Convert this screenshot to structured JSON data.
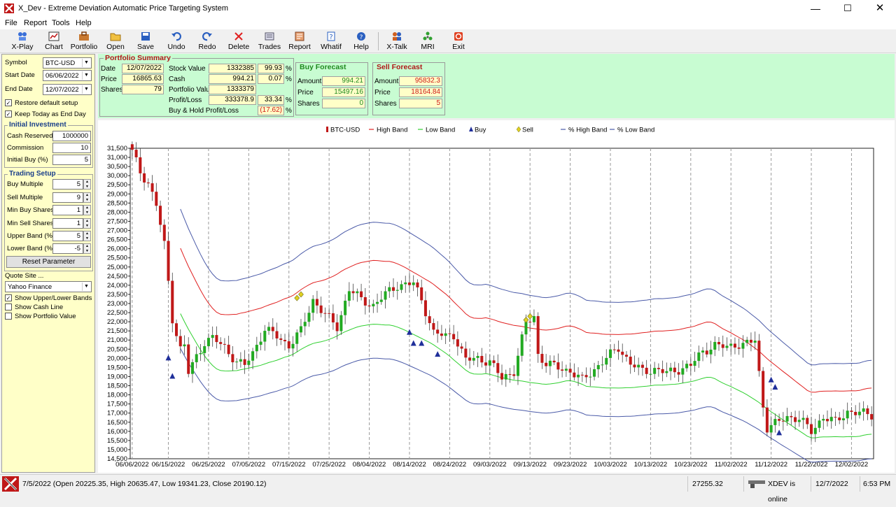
{
  "window": {
    "title": "X_Dev - Extreme Deviation Automatic Price Targeting System"
  },
  "menu": [
    "File",
    "Report",
    "Tools",
    "Help"
  ],
  "toolbar": [
    {
      "label": "X-Play",
      "icon": "play-icon"
    },
    {
      "label": "Chart",
      "icon": "chart-icon"
    },
    {
      "label": "Portfolio",
      "icon": "portfolio-icon"
    },
    {
      "label": "Open",
      "icon": "open-folder-icon"
    },
    {
      "label": "Save",
      "icon": "save-disk-icon"
    },
    {
      "label": "Undo",
      "icon": "undo-icon"
    },
    {
      "label": "Redo",
      "icon": "redo-icon"
    },
    {
      "label": "Delete",
      "icon": "delete-x-icon"
    },
    {
      "label": "Trades",
      "icon": "trades-icon"
    },
    {
      "label": "Report",
      "icon": "report-icon"
    },
    {
      "label": "Whatif",
      "icon": "whatif-icon"
    },
    {
      "label": "Help",
      "icon": "help-icon"
    },
    {
      "label": "X-Talk",
      "icon": "xtalk-icon"
    },
    {
      "label": "MRI",
      "icon": "mri-icon"
    },
    {
      "label": "Exit",
      "icon": "exit-icon"
    }
  ],
  "left": {
    "symbol_label": "Symbol",
    "symbol": "BTC-USD",
    "start_label": "Start Date",
    "start": "06/06/2022",
    "end_label": "End Date",
    "end": "12/07/2022",
    "restore_label": "Restore default setup",
    "keep_label": "Keep Today as End Day",
    "initial_head": "Initial Investment",
    "cash_label": "Cash Reserved",
    "cash": "1000000",
    "commission_label": "Commission",
    "commission": "10",
    "initbuy_label": "Initial Buy (%)",
    "initbuy": "5",
    "trading_head": "Trading Setup",
    "buym_label": "Buy Multiple",
    "buym": "5",
    "sellm_label": "Sell Multiple",
    "sellm": "9",
    "minbuy_label": "Min Buy Shares",
    "minbuy": "1",
    "minsell_label": "Min Sell Shares",
    "minsell": "1",
    "upper_label": "Upper Band (%)",
    "upper": "5",
    "lower_label": "Lower Band (%)",
    "lower": "-5",
    "reset_label": "Reset Parameter",
    "quote_label": "Quote Site ...",
    "quote": "Yahoo Finance",
    "show_bands_label": "Show Upper/Lower Bands",
    "show_cash_label": "Show Cash Line",
    "show_portfolio_label": "Show Portfolio Value"
  },
  "summary": {
    "head": "Portfolio Summary",
    "date_label": "Date",
    "date": "12/07/2022",
    "price_label": "Price",
    "price": "16865.63",
    "shares_label": "Shares",
    "shares": "79",
    "stock_label": "Stock Value",
    "stock": "1332385",
    "stock_pct": "99.93",
    "cash_label": "Cash",
    "cash": "994.21",
    "cash_pct": "0.07",
    "pv_label": "Portfolio Value",
    "pv": "1333379",
    "pl_label": "Profit/Loss",
    "pl": "333378.9",
    "pl_pct": "33.34",
    "bh_label": "Buy & Hold Profit/Loss",
    "bh_pct": "(17.62)",
    "pct": "%",
    "buy_head": "Buy Forecast",
    "buy_amount": "994.21",
    "buy_price": "15497.16",
    "buy_shares": "0",
    "sell_head": "Sell Forecast",
    "sell_amount": "95832.3",
    "sell_price": "18164.84",
    "sell_shares": "5",
    "amount_label": "Amount",
    "fprice_label": "Price",
    "fshares_label": "Shares"
  },
  "chart_data": {
    "type": "candlestick",
    "legend": [
      "BTC-USD",
      "High Band",
      "Low Band",
      "Buy",
      "Sell",
      "% High Band",
      "% Low Band"
    ],
    "legend_placement": "top",
    "colors": {
      "up": "#22aa22",
      "down": "#c01818",
      "high_band": "#e02020",
      "low_band": "#30d030",
      "pct_band": "#4a5aa8",
      "buy": "#1f2f9a",
      "sell": "#e0d020"
    },
    "ylim": [
      14500,
      31500
    ],
    "y_ticks": [
      "14,500",
      "15,000",
      "15,500",
      "16,000",
      "16,500",
      "17,000",
      "17,500",
      "18,000",
      "18,500",
      "19,000",
      "19,500",
      "20,000",
      "20,500",
      "21,000",
      "21,500",
      "22,000",
      "22,500",
      "23,000",
      "23,500",
      "24,000",
      "24,500",
      "25,000",
      "25,500",
      "26,000",
      "26,500",
      "27,000",
      "27,500",
      "28,000",
      "28,500",
      "29,000",
      "29,500",
      "30,000",
      "30,500",
      "31,000",
      "31,500"
    ],
    "x_ticks": [
      "06/06/2022",
      "06/15/2022",
      "06/25/2022",
      "07/05/2022",
      "07/15/2022",
      "07/25/2022",
      "08/04/2022",
      "08/14/2022",
      "08/24/2022",
      "09/03/2022",
      "09/13/2022",
      "09/23/2022",
      "10/03/2022",
      "10/13/2022",
      "10/23/2022",
      "11/02/2022",
      "11/12/2022",
      "11/22/2022",
      "12/02/2022"
    ],
    "x_tick_days": [
      0,
      9,
      19,
      29,
      39,
      49,
      59,
      69,
      79,
      89,
      99,
      109,
      119,
      129,
      139,
      149,
      159,
      169,
      179
    ],
    "days": 185,
    "close_key_days": [
      0,
      2,
      4,
      6,
      8,
      10,
      12,
      13,
      14,
      16,
      18,
      20,
      23,
      26,
      28,
      30,
      33,
      36,
      39,
      42,
      45,
      48,
      51,
      54,
      57,
      60,
      63,
      66,
      70,
      72,
      75,
      78,
      80,
      83,
      86,
      89,
      92,
      95,
      98,
      100,
      101,
      103,
      106,
      109,
      112,
      115,
      118,
      121,
      124,
      127,
      130,
      133,
      136,
      139,
      142,
      145,
      148,
      150,
      152,
      155,
      157,
      158,
      160,
      163,
      166,
      169,
      172,
      175,
      178,
      181,
      184
    ],
    "close_key_values": [
      31300,
      30200,
      29600,
      28400,
      26200,
      22200,
      20500,
      20700,
      19200,
      20100,
      20900,
      21100,
      20600,
      19800,
      19600,
      20300,
      21600,
      21200,
      20700,
      21500,
      23200,
      22400,
      21700,
      23800,
      23200,
      22900,
      23500,
      24000,
      24100,
      23200,
      21400,
      21200,
      21300,
      19900,
      20000,
      19800,
      18900,
      19300,
      21900,
      22300,
      20200,
      19700,
      19500,
      19300,
      18800,
      19400,
      20000,
      20600,
      19700,
      19300,
      19400,
      19200,
      19400,
      19600,
      20400,
      20700,
      20600,
      20800,
      20700,
      21000,
      17400,
      16200,
      16400,
      16800,
      16700,
      16000,
      16800,
      16500,
      17100,
      17000,
      16900
    ],
    "buys": [
      [
        9,
        20000
      ],
      [
        10,
        19000
      ],
      [
        69,
        21400
      ],
      [
        70,
        20800
      ],
      [
        72,
        20800
      ],
      [
        76,
        20200
      ],
      [
        159,
        18800
      ],
      [
        160,
        18400
      ],
      [
        161,
        15900
      ]
    ],
    "sells": [
      [
        41,
        23300
      ],
      [
        42,
        23500
      ],
      [
        98,
        22100
      ],
      [
        99,
        22300
      ]
    ]
  },
  "status": {
    "message": "7/5/2022 (Open 20225.35, High 20635.47, Low 19341.23, Close 20190.12)",
    "value": "27255.32",
    "online": "XDEV is online",
    "date": "12/7/2022",
    "time": "6:53 PM"
  }
}
